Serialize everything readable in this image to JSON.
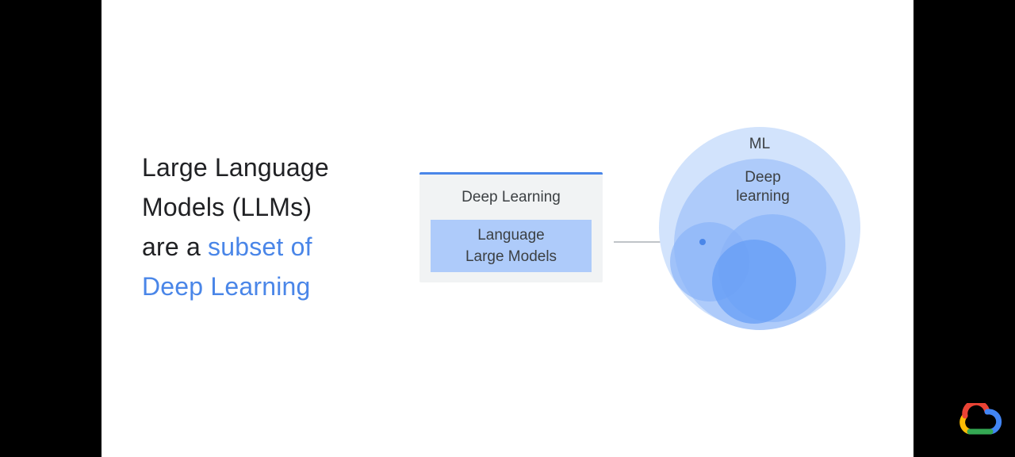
{
  "headline": {
    "line1": "Large Language",
    "line2": "Models (LLMs)",
    "line3_prefix": "are a ",
    "line3_accent": "subset of",
    "line4_accent": "Deep Learning"
  },
  "card": {
    "title": "Deep Learning",
    "inner_line1": "Language",
    "inner_line2": "Large Models"
  },
  "venn": {
    "outer_label": "ML",
    "middle_label_line1": "Deep",
    "middle_label_line2": "learning"
  },
  "colors": {
    "accent": "#4a86e8",
    "card_bg": "#f1f3f4",
    "card_inner": "#aecbfa",
    "ml_circle": "#d2e3fc",
    "dl_circle": "#aecbfa"
  },
  "logo": {
    "icon": "google-cloud-logo"
  }
}
